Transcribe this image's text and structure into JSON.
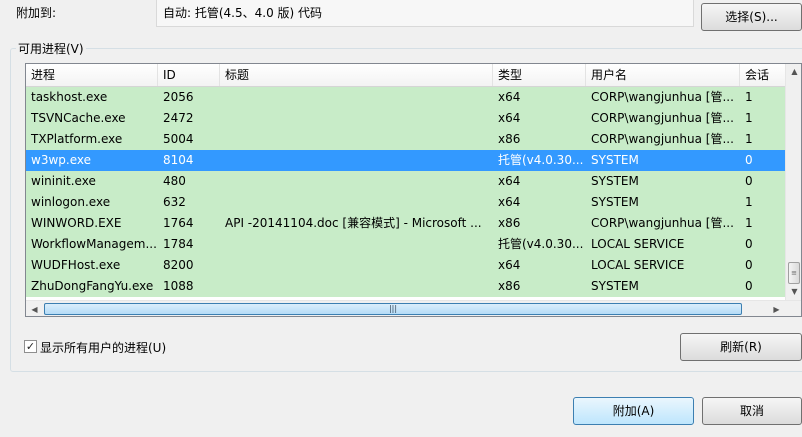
{
  "attach": {
    "label": "附加到:",
    "value": "自动: 托管(4.5、4.0 版) 代码",
    "select_button": "选择(S)..."
  },
  "processes": {
    "group_label": "可用进程(V)",
    "columns": [
      "进程",
      "ID",
      "标题",
      "类型",
      "用户名",
      "会话"
    ],
    "rows": [
      {
        "process": "taskhost.exe",
        "id": "2056",
        "title": "",
        "type": "x64",
        "user": "CORP\\wangjunhua [管...",
        "session": "1",
        "selected": false
      },
      {
        "process": "TSVNCache.exe",
        "id": "2472",
        "title": "",
        "type": "x64",
        "user": "CORP\\wangjunhua [管...",
        "session": "1",
        "selected": false
      },
      {
        "process": "TXPlatform.exe",
        "id": "5004",
        "title": "",
        "type": "x86",
        "user": "CORP\\wangjunhua [管...",
        "session": "1",
        "selected": false
      },
      {
        "process": "w3wp.exe",
        "id": "8104",
        "title": "",
        "type": "托管(v4.0.30...",
        "user": "SYSTEM",
        "session": "0",
        "selected": true
      },
      {
        "process": "wininit.exe",
        "id": "480",
        "title": "",
        "type": "x64",
        "user": "SYSTEM",
        "session": "0",
        "selected": false
      },
      {
        "process": "winlogon.exe",
        "id": "632",
        "title": "",
        "type": "x64",
        "user": "SYSTEM",
        "session": "1",
        "selected": false
      },
      {
        "process": "WINWORD.EXE",
        "id": "1764",
        "title": "API -20141104.doc [兼容模式] - Microsoft ...",
        "type": "x86",
        "user": "CORP\\wangjunhua [管...",
        "session": "1",
        "selected": false
      },
      {
        "process": "WorkflowManagem...",
        "id": "1784",
        "title": "",
        "type": "托管(v4.0.30...",
        "user": "LOCAL SERVICE",
        "session": "0",
        "selected": false
      },
      {
        "process": "WUDFHost.exe",
        "id": "8200",
        "title": "",
        "type": "x64",
        "user": "LOCAL SERVICE",
        "session": "0",
        "selected": false
      },
      {
        "process": "ZhuDongFangYu.exe",
        "id": "1088",
        "title": "",
        "type": "x86",
        "user": "SYSTEM",
        "session": "0",
        "selected": false
      }
    ],
    "row_bg": "#c8ecc8",
    "selected_bg": "#3399ff"
  },
  "show_all_users": {
    "label": "显示所有用户的进程(U)",
    "checked": true
  },
  "buttons": {
    "refresh": "刷新(R)",
    "attach": "附加(A)",
    "cancel": "取消"
  }
}
